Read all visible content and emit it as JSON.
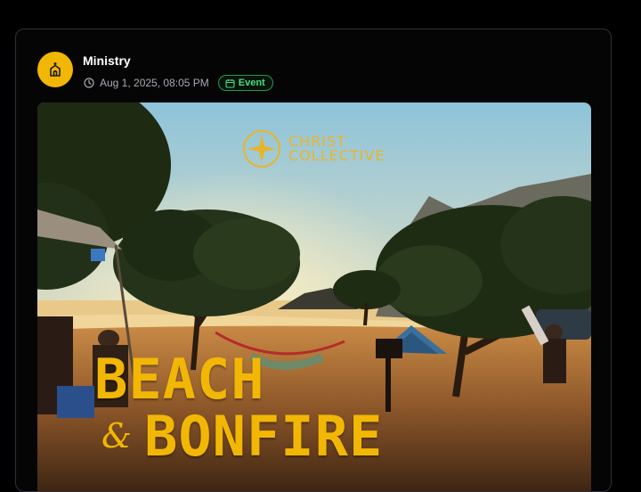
{
  "post": {
    "author": "Ministry",
    "timestamp": "Aug 1, 2025, 08:05 PM",
    "badge": "Event",
    "avatar_icon": "church-icon",
    "colors": {
      "avatar_bg": "#f2b705",
      "badge_green": "#4ade80",
      "accent_gold": "#f2b705"
    }
  },
  "flyer": {
    "brand_line1": "CHRIST",
    "brand_line2": "COLLECTIVE",
    "headline_line1": "BEACH",
    "ampersand": "&",
    "headline_line2": "BONFIRE"
  }
}
